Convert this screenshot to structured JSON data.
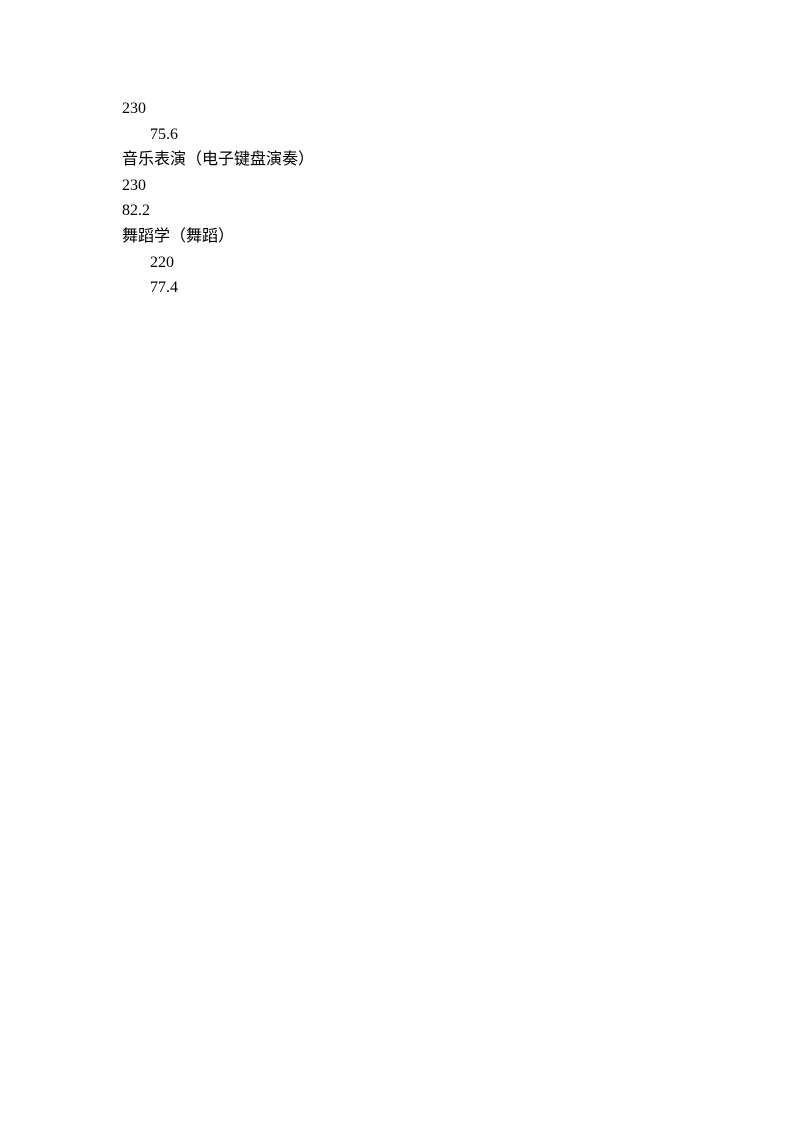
{
  "lines": [
    {
      "text": "230",
      "indent": false
    },
    {
      "text": "75.6",
      "indent": true
    },
    {
      "text": "音乐表演（电子键盘演奏）",
      "indent": false
    },
    {
      "text": "230",
      "indent": false
    },
    {
      "text": "82.2",
      "indent": false
    },
    {
      "text": "舞蹈学（舞蹈）",
      "indent": false
    },
    {
      "text": "220",
      "indent": true
    },
    {
      "text": "77.4",
      "indent": true
    }
  ]
}
